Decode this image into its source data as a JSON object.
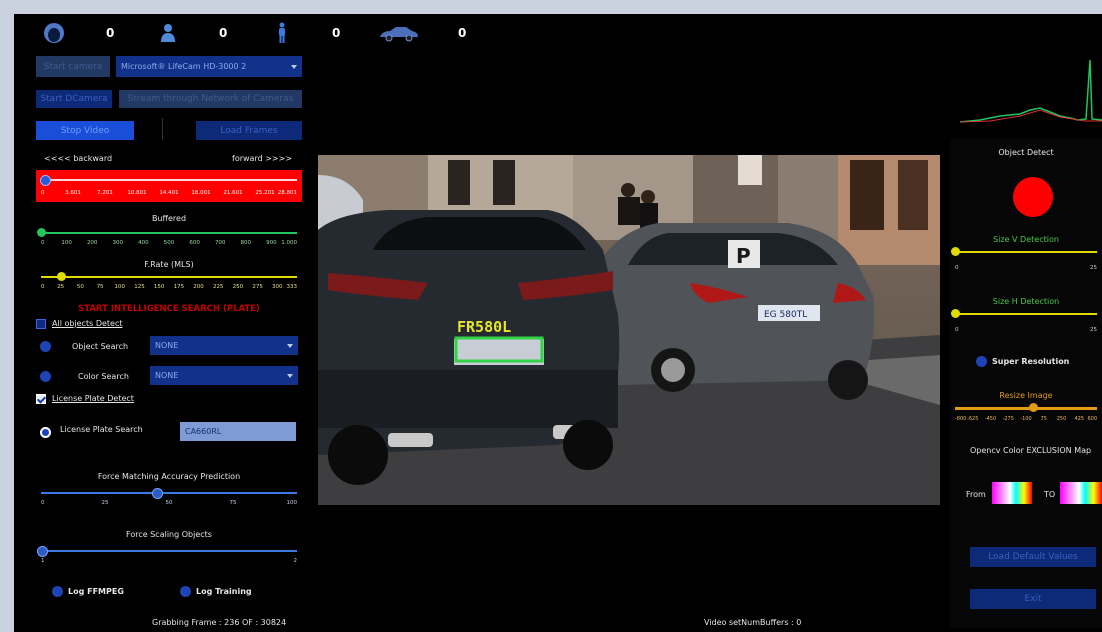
{
  "counters": [
    {
      "icon": "face-icon",
      "value": "0"
    },
    {
      "icon": "person-icon",
      "value": "0"
    },
    {
      "icon": "pedestrian-icon",
      "value": "0"
    },
    {
      "icon": "car-icon",
      "value": "0"
    }
  ],
  "controls": {
    "start_camera": "Start camera",
    "camera_select": "Microsoft® LifeCam HD-3000 2",
    "start_dcamera": "Start DCamera",
    "stream_button": "Stream through Network of Cameras",
    "stop_video": "Stop Video",
    "load_frames": "Load Frames"
  },
  "navigation": {
    "backward": "<<<< backward",
    "forward": "forward >>>>"
  },
  "sliders": {
    "position": {
      "ticks": [
        "0",
        "3.601",
        "7.201",
        "10.801",
        "14.401",
        "18.001",
        "21.601",
        "25.201",
        "28.801"
      ],
      "value_fraction": 0.01
    },
    "buffered": {
      "label": "Buffered",
      "ticks": [
        "0",
        "100",
        "200",
        "300",
        "400",
        "500",
        "600",
        "700",
        "800",
        "900",
        "1.000"
      ],
      "value_fraction": 0.0
    },
    "frame_rate": {
      "label": "F.Rate (MLS)",
      "ticks": [
        "0",
        "25",
        "50",
        "75",
        "100",
        "125",
        "150",
        "175",
        "200",
        "225",
        "250",
        "275",
        "300",
        "333"
      ],
      "value_fraction": 0.08
    },
    "accuracy": {
      "label": "Force Matching Accuracy Prediction",
      "ticks": [
        "0",
        "25",
        "50",
        "75",
        "100"
      ],
      "value_fraction": 0.45
    },
    "scaling": {
      "label": "Force Scaling Objects",
      "ticks": [
        "1",
        "2"
      ],
      "value_fraction": 0.0
    },
    "size_v": {
      "label": "Size V Detection",
      "ticks": [
        "0",
        "25"
      ],
      "value_fraction": 0.0
    },
    "size_h": {
      "label": "Size H Detection",
      "ticks": [
        "0",
        "25"
      ],
      "value_fraction": 0.0
    },
    "resize": {
      "label": "Resize Image",
      "ticks": [
        "-800",
        "-625",
        "-450",
        "-275",
        "-100",
        "75",
        "250",
        "425",
        "600"
      ],
      "value_fraction": 0.55
    }
  },
  "search": {
    "intelligence_banner": "START INTELLIGENCE SEARCH (PLATE)",
    "all_objects": "All objects Detect",
    "object_search": {
      "label": "Object Search",
      "value": "NONE"
    },
    "color_search": {
      "label": "Color Search",
      "value": "NONE"
    },
    "license_plate_detect": "License Plate Detect",
    "license_plate_search": {
      "label": "License Plate Search",
      "value": "CA660RL"
    }
  },
  "logs": {
    "ffmpeg": "Log FFMPEG",
    "training": "Log Training"
  },
  "status": {
    "grabbing": "Grabbing Frame : 236 OF : 30824",
    "buffers": "Video setNumBuffers : 0"
  },
  "video": {
    "plate_text": "FR580L",
    "car_plate_right": "EG 580TL"
  },
  "right_panel": {
    "object_detect": "Object Detect",
    "super_resolution": "Super Resolution",
    "exclusion_map": "Opencv Color EXCLUSION Map",
    "from": "From",
    "to": "TO",
    "load_default": "Load Default Values",
    "exit": "Exit"
  },
  "colors": {
    "accent_blue": "#12318a",
    "red_slider": "#ff0000",
    "green": "#22c55e",
    "yellow": "#e0dc00",
    "orange": "#e39a15"
  }
}
